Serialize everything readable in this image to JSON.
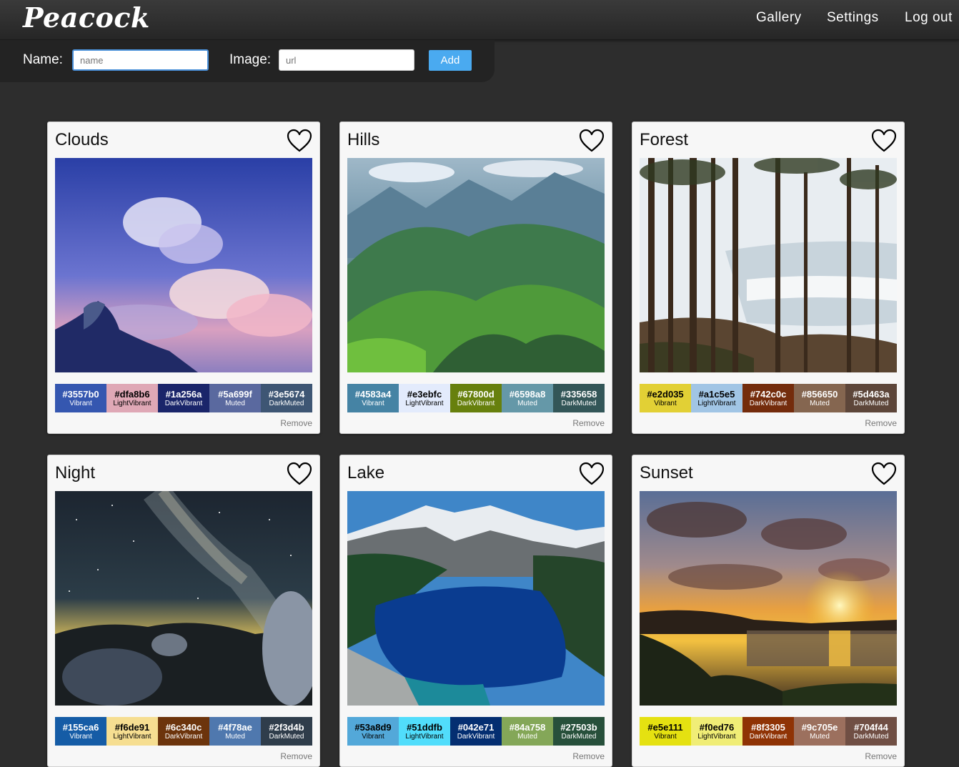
{
  "app": {
    "brand": "Peacock"
  },
  "nav": [
    {
      "label": "Gallery"
    },
    {
      "label": "Settings"
    },
    {
      "label": "Log out"
    }
  ],
  "form": {
    "name_label": "Name:",
    "name_placeholder": "name",
    "name_value": "",
    "image_label": "Image:",
    "image_placeholder": "url",
    "image_value": "",
    "add_label": "Add"
  },
  "cards": [
    {
      "title": "Clouds",
      "image_desc": "Anime-style sky with billowing clouds",
      "favorited": false,
      "remove_label": "Remove",
      "palette": [
        {
          "hex": "#3557b0",
          "name": "Vibrant",
          "color": "#3557b0",
          "text": "#ffffff"
        },
        {
          "hex": "#dfa8b6",
          "name": "LightVibrant",
          "color": "#dfa8b6",
          "text": "#000000"
        },
        {
          "hex": "#1a256a",
          "name": "DarkVibrant",
          "color": "#1a256a",
          "text": "#ffffff"
        },
        {
          "hex": "#5a699f",
          "name": "Muted",
          "color": "#5a699f",
          "text": "#ffffff"
        },
        {
          "hex": "#3e5674",
          "name": "DarkMuted",
          "color": "#3e5674",
          "text": "#ffffff"
        }
      ]
    },
    {
      "title": "Hills",
      "image_desc": "Green rolling hills with mountains behind",
      "favorited": false,
      "remove_label": "Remove",
      "palette": [
        {
          "hex": "#4583a4",
          "name": "Vibrant",
          "color": "#4583a4",
          "text": "#ffffff"
        },
        {
          "hex": "#e3ebfc",
          "name": "LightVibrant",
          "color": "#e3ebfc",
          "text": "#000000"
        },
        {
          "hex": "#67800d",
          "name": "DarkVibrant",
          "color": "#67800d",
          "text": "#ffffff"
        },
        {
          "hex": "#6598a8",
          "name": "Muted",
          "color": "#6598a8",
          "text": "#ffffff"
        },
        {
          "hex": "#335658",
          "name": "DarkMuted",
          "color": "#335658",
          "text": "#ffffff"
        }
      ]
    },
    {
      "title": "Forest",
      "image_desc": "Tall pine trees on a cliff above the sea",
      "favorited": false,
      "remove_label": "Remove",
      "palette": [
        {
          "hex": "#e2d035",
          "name": "Vibrant",
          "color": "#e2d035",
          "text": "#000000"
        },
        {
          "hex": "#a1c5e5",
          "name": "LightVibrant",
          "color": "#a1c5e5",
          "text": "#000000"
        },
        {
          "hex": "#742c0c",
          "name": "DarkVibrant",
          "color": "#742c0c",
          "text": "#ffffff"
        },
        {
          "hex": "#856650",
          "name": "Muted",
          "color": "#856650",
          "text": "#ffffff"
        },
        {
          "hex": "#5d463a",
          "name": "DarkMuted",
          "color": "#5d463a",
          "text": "#ffffff"
        }
      ]
    },
    {
      "title": "Night",
      "image_desc": "Milky way over rocky landscape",
      "favorited": false,
      "remove_label": "Remove",
      "palette": [
        {
          "hex": "#155ca6",
          "name": "Vibrant",
          "color": "#155ca6",
          "text": "#ffffff"
        },
        {
          "hex": "#f6de91",
          "name": "LightVibrant",
          "color": "#f6de91",
          "text": "#000000"
        },
        {
          "hex": "#6c340c",
          "name": "DarkVibrant",
          "color": "#6c340c",
          "text": "#ffffff"
        },
        {
          "hex": "#4f78ae",
          "name": "Muted",
          "color": "#4f78ae",
          "text": "#ffffff"
        },
        {
          "hex": "#2f3d4b",
          "name": "DarkMuted",
          "color": "#2f3d4b",
          "text": "#ffffff"
        }
      ]
    },
    {
      "title": "Lake",
      "image_desc": "Deep blue mountain lake with snowy peaks",
      "favorited": false,
      "remove_label": "Remove",
      "palette": [
        {
          "hex": "#53a8d9",
          "name": "Vibrant",
          "color": "#53a8d9",
          "text": "#000000"
        },
        {
          "hex": "#51ddfb",
          "name": "LightVibrant",
          "color": "#51ddfb",
          "text": "#000000"
        },
        {
          "hex": "#042e71",
          "name": "DarkVibrant",
          "color": "#042e71",
          "text": "#ffffff"
        },
        {
          "hex": "#84a758",
          "name": "Muted",
          "color": "#84a758",
          "text": "#ffffff"
        },
        {
          "hex": "#27503b",
          "name": "DarkMuted",
          "color": "#27503b",
          "text": "#ffffff"
        }
      ]
    },
    {
      "title": "Sunset",
      "image_desc": "Sunset over the sea with dramatic clouds",
      "favorited": false,
      "remove_label": "Remove",
      "palette": [
        {
          "hex": "#e5e111",
          "name": "Vibrant",
          "color": "#e5e111",
          "text": "#000000"
        },
        {
          "hex": "#f0ed76",
          "name": "LightVibrant",
          "color": "#f0ed76",
          "text": "#000000"
        },
        {
          "hex": "#8f3305",
          "name": "DarkVibrant",
          "color": "#8f3305",
          "text": "#ffffff"
        },
        {
          "hex": "#9c705e",
          "name": "Muted",
          "color": "#9c705e",
          "text": "#ffffff"
        },
        {
          "hex": "#704f44",
          "name": "DarkMuted",
          "color": "#704f44",
          "text": "#ffffff"
        }
      ]
    }
  ]
}
